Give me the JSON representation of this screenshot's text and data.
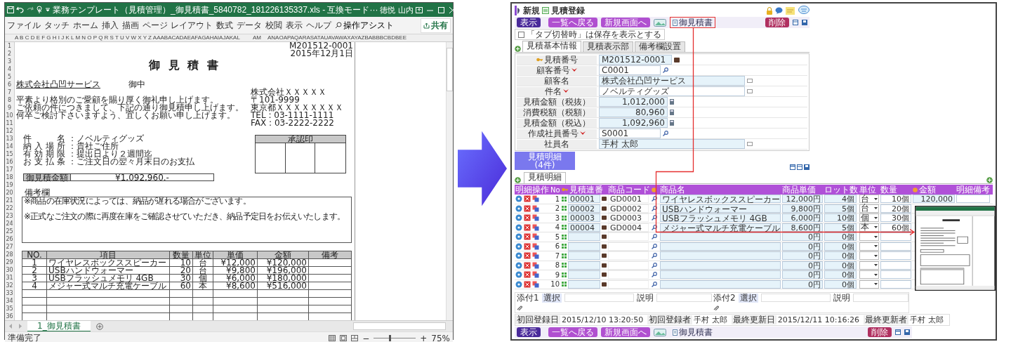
{
  "excel": {
    "title": "業務テンプレート（見積管理）_御見積書_5840782_181226135337.xls  -  互換モード···",
    "user": "徳悦 山内",
    "ribbon": [
      "ファイル",
      "タッチ",
      "ホーム",
      "挿入",
      "描画",
      "ページ レイアウト",
      "数式",
      "データ",
      "校閲",
      "表示",
      "ヘルプ"
    ],
    "assist": "操作アシスト",
    "share": "共有",
    "column_headers": [
      "A B C D E F G H I J K L M N O P Q R S T U V W X Y Z AAABACADAEAFAGAHAIAJAKAL",
      "AM",
      "ANAOAPAQARASATAUAVAWAXAYAZBABBBCBDBEE"
    ],
    "row_numbers": [
      "1",
      "2",
      "3",
      "4",
      "5",
      "6",
      "7",
      "8",
      "9",
      "10",
      "11",
      "12",
      "13",
      "14",
      "15",
      "16",
      "17",
      "18",
      "19",
      "20",
      "21",
      "22",
      "23",
      "24",
      "25",
      "26",
      "27",
      "28",
      "29",
      "30",
      "31",
      "32",
      "33",
      "34",
      "35",
      "36"
    ],
    "sheet": {
      "number": "M201512-0001",
      "date": "2015年12月1日",
      "title": "御 見 積 書",
      "customer": "株式会社凸凹サービス",
      "honorific": "御中",
      "greeting": [
        "平素より格別のご愛顧を賜り厚く御礼申し上げます。",
        "ご依頼の件につきまして、下記の通り御見積申し上げます。",
        "何卒ご検討下さいますよう、宜しくお願い申し上げます。"
      ],
      "sender": [
        "株式会社ＸＸＸＸＸ",
        "〒101-9999",
        "東京都ＸＸＸＸＸＸＸＸ",
        "TEL : 03-1111-1111",
        "FAX : 03-2222-2222"
      ],
      "details": [
        {
          "label": "件名",
          "value": "：ノベルティグッズ"
        },
        {
          "label": "納入場所",
          "value": "：貴社ご住所"
        },
        {
          "label": "有効期限",
          "value": "：提出日より２週間迄"
        },
        {
          "label": "お支払条",
          "value": "：ご注文日の翌々月末日のお支払"
        }
      ],
      "stamp": "承認印",
      "total_label": "御見積金額",
      "total": "¥1,092,960.-",
      "notes_label": "備考欄",
      "notes": [
        "※商品の在庫状況によっては、納品が遅れる場合がございます。",
        "※正式なご注文の際に再度在庫をご確認させていただき、納品予定日をお伝えいたします。"
      ],
      "table": {
        "columns": [
          "NO.",
          "項目",
          "数量",
          "単位",
          "単価",
          "金額",
          "備考"
        ],
        "rows": [
          [
            "1",
            "ワイヤレスボックススピーカー",
            "10",
            "台",
            "¥12,000",
            "¥120,000"
          ],
          [
            "2",
            "USBハンドウォーマー",
            "20",
            "台",
            "¥9,800",
            "¥196,000"
          ],
          [
            "3",
            "USBフラッシュメモリ 4GB",
            "30",
            "個",
            "¥6,000",
            "¥180,000"
          ],
          [
            "4",
            "メジャー式マルチ充電ケーブル",
            "60",
            "本",
            "¥8,600",
            "¥516,000"
          ]
        ]
      }
    },
    "sheet_tab": {
      "label": "1_御見積書",
      "selected": true
    },
    "status": "準備完了",
    "zoom_out": "−",
    "zoom_in": "+",
    "zoom": {
      "level": 0.37
    },
    "zoom_label": "75%"
  },
  "app": {
    "logo": "新規",
    "title": "見積登録",
    "toolbar": [
      {
        "label": "表示",
        "kind": "primary"
      },
      {
        "label": "一覧へ戻る",
        "kind": "secondary"
      },
      {
        "label": "新規画面へ",
        "kind": "secondary"
      },
      {
        "label": "御見積書",
        "kind": "report",
        "highlighted": true
      }
    ],
    "delete": "削除",
    "checkbox": {
      "label": "「タブ切替時」は保存を表示とする",
      "checked": false
    },
    "tabs": [
      {
        "label": "見積基本情報",
        "selected": true
      },
      {
        "label": "見積表示部",
        "selected": false
      },
      {
        "label": "備考欄設置",
        "selected": false
      }
    ],
    "fields": [
      {
        "label": "見積番号",
        "kind": "key",
        "required": false,
        "editable": false,
        "value": "M201512-0001"
      },
      {
        "label": "顧客番号",
        "kind": "lookup",
        "required": true,
        "editable": true,
        "value": "C0001"
      },
      {
        "label": "顧客名",
        "kind": "text",
        "required": false,
        "editable": false,
        "value": "株式会社凸凹サービス"
      },
      {
        "label": "件名",
        "kind": "text",
        "required": true,
        "editable": true,
        "value": "ノベルティグッズ"
      },
      {
        "label": "見積金額（税抜）",
        "kind": "amount",
        "required": false,
        "editable": false,
        "value": "1,012,000"
      },
      {
        "label": "消費税額（税額）",
        "kind": "amount",
        "required": false,
        "editable": false,
        "value": "80,960"
      },
      {
        "label": "見積金額（税込）",
        "kind": "amount",
        "required": false,
        "editable": false,
        "value": "1,092,960"
      },
      {
        "label": "作成社員番号",
        "kind": "lookup",
        "required": true,
        "editable": true,
        "value": "S0001"
      },
      {
        "label": "社員名",
        "kind": "text",
        "required": false,
        "editable": false,
        "value": "手村 太郎"
      }
    ],
    "detail_button": [
      "見積明細",
      "(4件)"
    ],
    "detail_tab": "見積明細",
    "columns": [
      "明細操作",
      "No",
      "見積連番",
      "商品コード",
      "商品名",
      "商品単価",
      "ロット数",
      "単位",
      "数量",
      "金額",
      "明細備考"
    ],
    "rows": [
      {
        "no": "1",
        "seq": "00001",
        "code": "GD0001",
        "name": "ワイヤレスボックススピーカー",
        "price": "12,000円",
        "lot": "4個",
        "unit": "台",
        "qty": "10個",
        "amount": "120,000"
      },
      {
        "no": "2",
        "seq": "00002",
        "code": "GD0002",
        "name": "USBハンドウォーマー",
        "price": "9,800円",
        "lot": "5個",
        "unit": "台",
        "qty": "20個"
      },
      {
        "no": "3",
        "seq": "00003",
        "code": "GD0003",
        "name": "USBフラッシュメモリ 4GB",
        "price": "6,000円",
        "lot": "10個",
        "unit": "個",
        "qty": "30個"
      },
      {
        "no": "4",
        "seq": "00004",
        "code": "GD0004",
        "name": "メジャー式マルチ充電ケーブル",
        "price": "8,600円",
        "lot": "5個",
        "unit": "本",
        "qty": "60個"
      },
      {
        "no": "5",
        "price": "0円",
        "lot": "0個"
      },
      {
        "no": "6",
        "price": "0円",
        "lot": "0個"
      },
      {
        "no": "7",
        "price": "0円",
        "lot": "0個"
      },
      {
        "no": "8",
        "price": "0円",
        "lot": "0個"
      },
      {
        "no": "9",
        "price": "0円",
        "lot": "0個"
      },
      {
        "no": "10",
        "price": "0円",
        "lot": "0個"
      }
    ],
    "attachments": [
      {
        "label": "添付1",
        "button": "選択",
        "note": "説明"
      },
      {
        "label": "添付2",
        "button": "選択",
        "note": "説明"
      }
    ],
    "audit": [
      {
        "label": "初回登録日",
        "value": "2015/12/10 13:20:50"
      },
      {
        "label": "初回登録者",
        "value": "手村 太郎"
      },
      {
        "label": "最終更新日",
        "value": "2015/12/11 10:16:26"
      },
      {
        "label": "最終更新者",
        "value": "手村 太郎"
      }
    ],
    "bottom_toolbar": [
      {
        "label": "表示",
        "kind": "primary"
      },
      {
        "label": "一覧へ戻る",
        "kind": "secondary"
      },
      {
        "label": "新規画面へ",
        "kind": "secondary"
      },
      {
        "label": "御見積書",
        "kind": "report",
        "highlighted": false
      }
    ],
    "bottom_delete": "削除"
  }
}
